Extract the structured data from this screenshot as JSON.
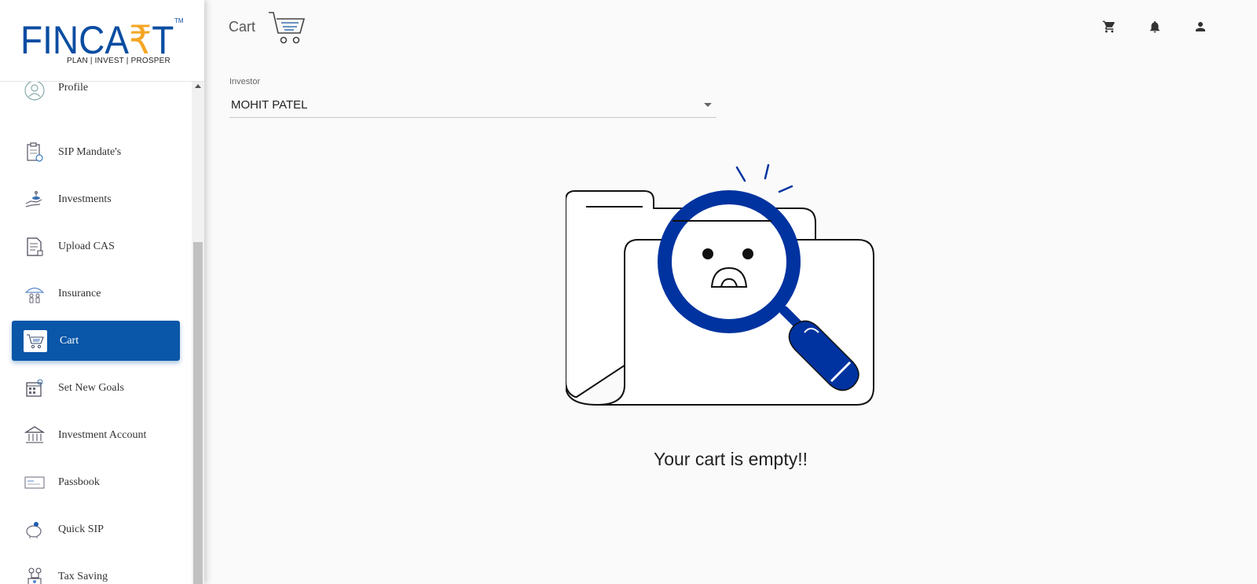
{
  "brand": {
    "name_part1": "FINCA",
    "name_rupee": "₹",
    "name_part2": "T",
    "tm": "TM",
    "tagline": "PLAN | INVEST | PROSPER"
  },
  "sidebar": {
    "items": [
      {
        "label": "Profile",
        "icon": "profile-icon"
      },
      {
        "label": "SIP Mandate's",
        "icon": "clipboard-icon"
      },
      {
        "label": "Investments",
        "icon": "hand-money-icon"
      },
      {
        "label": "Upload CAS",
        "icon": "document-icon"
      },
      {
        "label": "Insurance",
        "icon": "umbrella-family-icon"
      },
      {
        "label": "Cart",
        "icon": "cart-icon",
        "active": true
      },
      {
        "label": "Set New Goals",
        "icon": "goal-calendar-icon"
      },
      {
        "label": "Investment Account",
        "icon": "bank-icon"
      },
      {
        "label": "Passbook",
        "icon": "passbook-icon"
      },
      {
        "label": "Quick SIP",
        "icon": "piggy-bank-icon"
      },
      {
        "label": "Tax Saving",
        "icon": "tax-saving-icon"
      }
    ]
  },
  "header": {
    "title": "Cart",
    "icons": [
      "cart-icon",
      "bell-icon",
      "account-icon"
    ]
  },
  "investor": {
    "label": "Investor",
    "value": "MOHIT PATEL"
  },
  "empty_state": {
    "message": "Your cart is empty!!"
  },
  "colors": {
    "brand_blue": "#0a56a8",
    "illustration_blue": "#0033a0",
    "accent_orange": "#f5a623"
  }
}
